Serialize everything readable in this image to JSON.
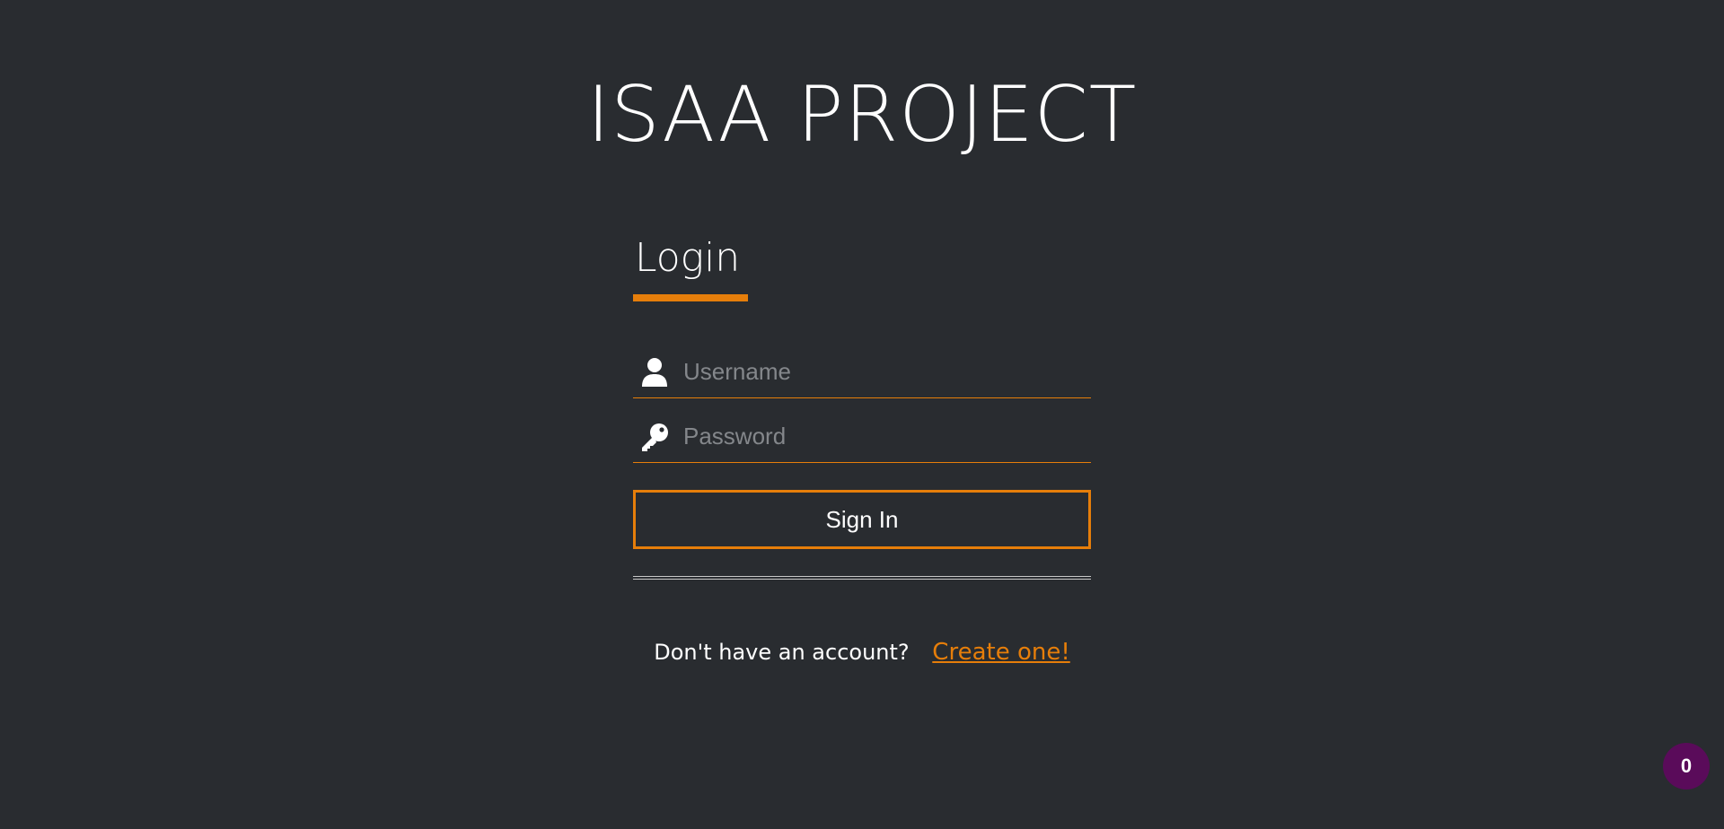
{
  "app": {
    "title": "ISAA PROJECT"
  },
  "login": {
    "heading": "Login",
    "username": {
      "placeholder": "Username",
      "value": "",
      "icon": "user-icon"
    },
    "password": {
      "placeholder": "Password",
      "value": "",
      "icon": "key-icon"
    },
    "sign_in_label": "Sign In",
    "signup_prompt": "Don't have an account?",
    "signup_link": "Create one!"
  },
  "badge": {
    "count": "0"
  },
  "colors": {
    "background": "#292c30",
    "accent": "#e67e0a",
    "badge": "#5a0b5a"
  }
}
